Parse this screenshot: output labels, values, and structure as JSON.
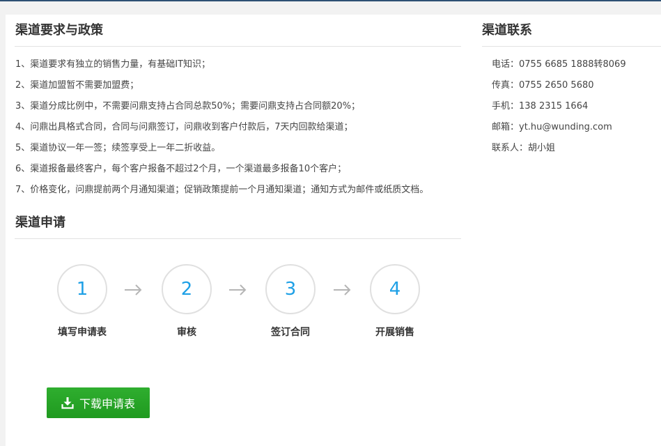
{
  "requirements": {
    "title": "渠道要求与政策",
    "items": [
      "1、渠道要求有独立的销售力量，有基础IT知识；",
      "2、渠道加盟暂不需要加盟费；",
      "3、渠道分成比例中，不需要问鼎支持占合同总款50%；需要问鼎支持占合同额20%；",
      "4、问鼎出具格式合同，合同与问鼎签订，问鼎收到客户付款后，7天内回款给渠道；",
      "5、渠道协议一年一签；续签享受上一年二折收益。",
      "6、渠道报备最终客户，每个客户报备不超过2个月，一个渠道最多报备10个客户；",
      "7、价格变化，问鼎提前两个月通知渠道；促销政策提前一个月通知渠道；通知方式为邮件或纸质文档。"
    ]
  },
  "application": {
    "title": "渠道申请",
    "steps": [
      {
        "number": "1",
        "label": "填写申请表"
      },
      {
        "number": "2",
        "label": "审核"
      },
      {
        "number": "3",
        "label": "签订合同"
      },
      {
        "number": "4",
        "label": "开展销售"
      }
    ],
    "download_label": "下载申请表"
  },
  "contact": {
    "title": "渠道联系",
    "items": [
      "电话：0755 6685 1888转8069",
      "传真：0755 2650 5680",
      "手机：138 2315 1664",
      "邮箱：yt.hu@wunding.com",
      "联系人：胡小姐"
    ]
  },
  "colors": {
    "accent": "#1ea0e6",
    "button": "#24a024",
    "top_border": "#2d4f74"
  },
  "icons": {
    "download": "download-icon",
    "arrow": "arrow-right-icon"
  }
}
